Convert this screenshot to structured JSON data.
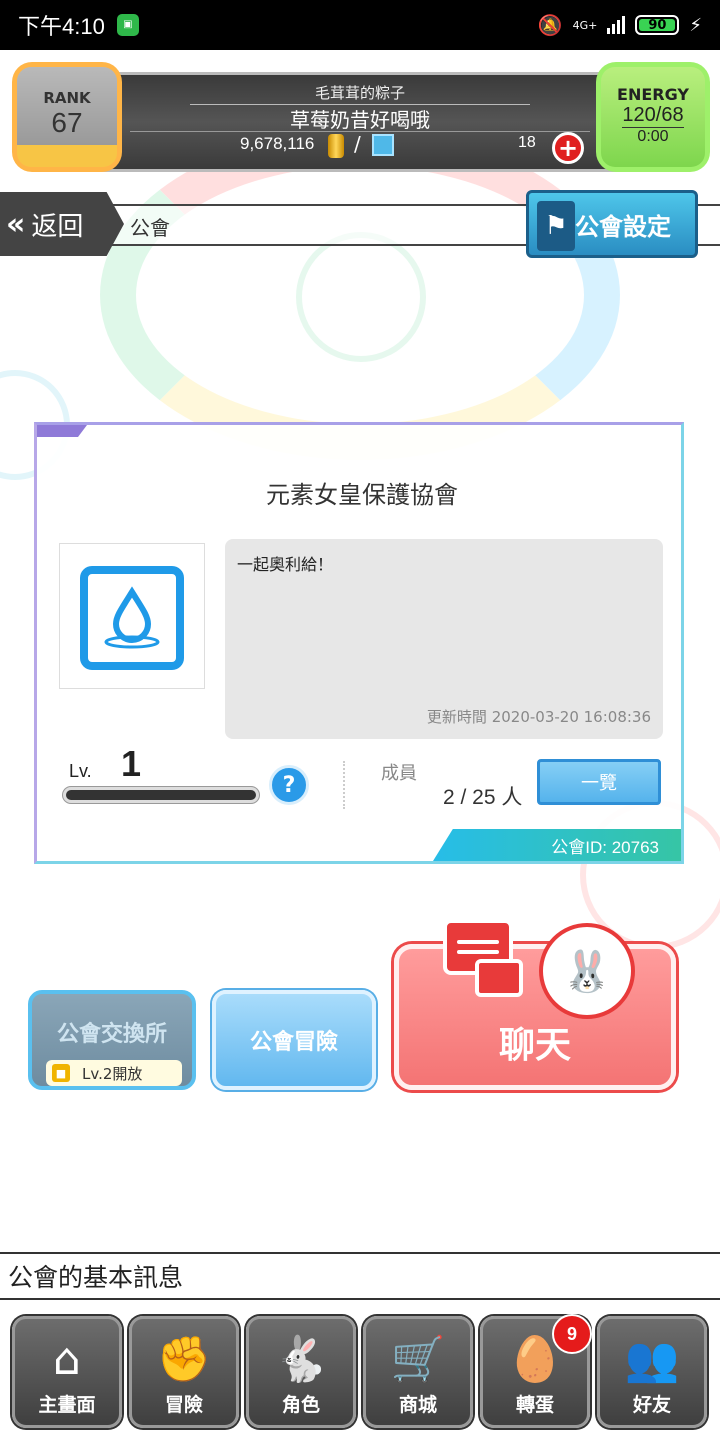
{
  "status_bar": {
    "time": "下午4:10",
    "network": "4G+",
    "battery": "90"
  },
  "hud": {
    "rank_label": "RANK",
    "rank_value": "67",
    "player_name": "毛茸茸的粽子",
    "guild_name": "草莓奶昔好喝哦",
    "gold": "9,678,116",
    "separator": "/",
    "gems": "18",
    "energy_label": "ENERGY",
    "energy_value": "120/68",
    "energy_timer": "0:00"
  },
  "nav": {
    "back_label": "返回",
    "breadcrumb": "公會",
    "settings_label": "公會設定"
  },
  "guild": {
    "name": "元素女皇保護協會",
    "message": "一起奧利給！",
    "updated_at": "更新時間 2020-03-20 16:08:36",
    "level_label": "Lv.",
    "level_value": "1",
    "members_label": "成員",
    "members_value": "2 / 25 人",
    "list_button": "一覽",
    "guild_id": "公會ID: 20763"
  },
  "actions": {
    "exchange_label": "公會交換所",
    "exchange_lock": "Lv.2開放",
    "adventure_label": "公會冒險",
    "chat_label": "聊天"
  },
  "info_bar": "公會的基本訊息",
  "bottom_nav": [
    {
      "label": "主畫面",
      "icon": "home-icon"
    },
    {
      "label": "冒險",
      "icon": "fist-icon"
    },
    {
      "label": "角色",
      "icon": "bunny-icon"
    },
    {
      "label": "商城",
      "icon": "cart-icon"
    },
    {
      "label": "轉蛋",
      "icon": "egg-icon",
      "badge": "9"
    },
    {
      "label": "好友",
      "icon": "friends-icon"
    }
  ],
  "colors": {
    "rank_accent": "#ffb547",
    "energy_accent": "#9ef06a",
    "primary_blue": "#2a9ae8",
    "chat_red": "#f47474"
  }
}
